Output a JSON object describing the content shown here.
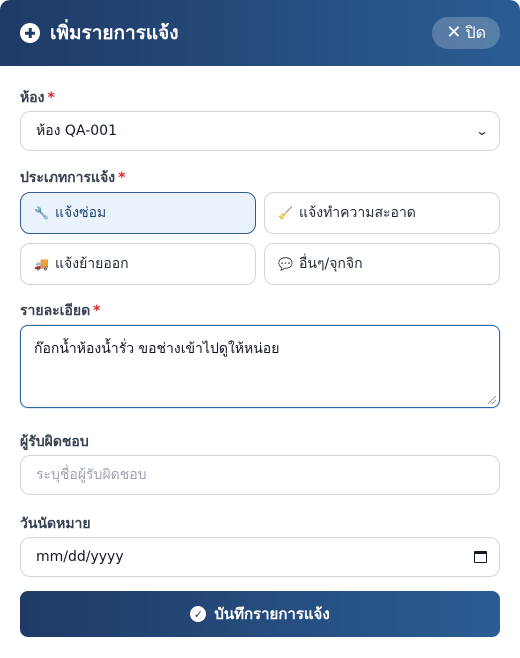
{
  "header": {
    "title": "เพิ่มรายการแจ้ง",
    "close_label": "ปิด",
    "close_icon": "✕"
  },
  "room": {
    "label": "ห้อง",
    "required": "*",
    "selected": "ห้อง QA-001"
  },
  "type": {
    "label": "ประเภทการแจ้ง",
    "required": "*",
    "options": [
      {
        "icon": "🔧",
        "label": "แจ้งซ่อม",
        "active": true
      },
      {
        "icon": "🧹",
        "label": "แจ้งทำความสะอาด",
        "active": false
      },
      {
        "icon": "🚚",
        "label": "แจ้งย้ายออก",
        "active": false
      },
      {
        "icon": "💬",
        "label": "อื่นๆ/จุกจิก",
        "active": false
      }
    ]
  },
  "detail": {
    "label": "รายละเอียด",
    "required": "*",
    "value": "ก๊อกน้ำห้องน้ำรั่ว ขอช่างเข้าไปดูให้หน่อย"
  },
  "assignee": {
    "label": "ผู้รับผิดชอบ",
    "placeholder": "ระบุชื่อผู้รับผิดชอบ"
  },
  "appointment": {
    "label": "วันนัดหมาย",
    "placeholder": "mm/dd/yyyy"
  },
  "submit": {
    "label": "บันทึกรายการแจ้ง",
    "icon": "✓"
  },
  "colors": {
    "header_start": "#1f3a66",
    "header_end": "#2b5d93",
    "required": "#dc2626",
    "active_bg": "#eaf3fc"
  }
}
